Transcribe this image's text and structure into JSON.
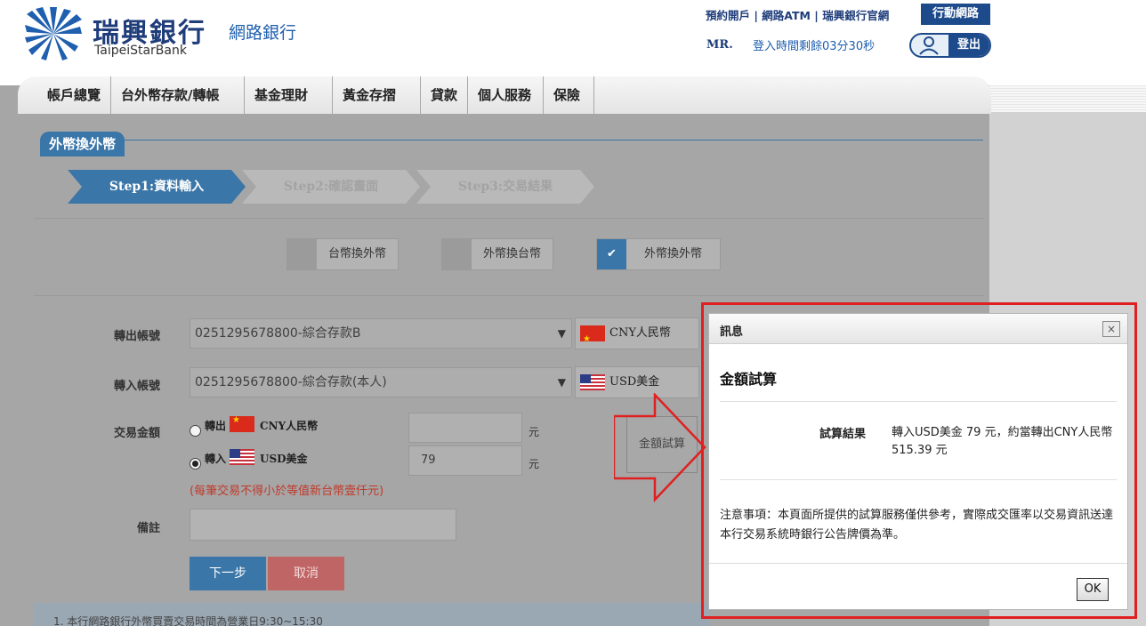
{
  "header": {
    "brand_name": "瑞興銀行",
    "brand_sub": "網路銀行",
    "brand_en": "TaipeiStarBank",
    "top_links": "預約開戶 | 網路ATM | 瑞興銀行官網",
    "mobile_label": "行動網路",
    "user_title": "MR.",
    "session_text": "登入時間剩餘03分30秒",
    "logout_label": "登出"
  },
  "nav": {
    "items": [
      "帳戶總覽",
      "台外幣存款/轉帳",
      "基金理財",
      "黃金存摺",
      "貸款",
      "個人服務",
      "保險"
    ]
  },
  "page": {
    "section_title": "外幣換外幣",
    "steps": [
      "Step1:資料輸入",
      "Step2:確認畫面",
      "Step3:交易結果"
    ],
    "options": [
      "台幣換外幣",
      "外幣換台幣",
      "外幣換外幣"
    ],
    "check_glyph": "✔"
  },
  "form": {
    "from_label": "轉出帳號",
    "from_account": "0251295678800-綜合存款B",
    "from_currency": "CNY人民幣",
    "to_label": "轉入帳號",
    "to_account": "0251295678800-綜合存款(本人)",
    "to_currency": "USD美金",
    "amount_label": "交易金額",
    "out_prefix": "轉出",
    "out_currency": "CNY人民幣",
    "in_prefix": "轉入",
    "in_currency": "USD美金",
    "out_value": "",
    "in_value": "79",
    "unit": "元",
    "limit_note": "(每筆交易不得小於等值新台幣壹仟元)",
    "calc_button": "金額試算",
    "remark_label": "備註",
    "remark_value": "",
    "next_button": "下一步",
    "cancel_button": "取消",
    "info_text": "1. 本行網路銀行外幣買賣交易時間為營業日9:30~15:30"
  },
  "dialog": {
    "title": "訊息",
    "close_glyph": "×",
    "heading": "金額試算",
    "result_label": "試算結果",
    "result_text": "轉入USD美金 79 元，約當轉出CNY人民幣 515.39 元",
    "notice": "注意事項：本頁面所提供的試算服務僅供參考，實際成交匯率以交易資訊送達本行交易系統時銀行公告牌價為準。",
    "ok_label": "OK"
  },
  "colors": {
    "brand_blue": "#1d4a8a",
    "accent_blue": "#3b76a8",
    "highlight_red": "#e02020"
  }
}
